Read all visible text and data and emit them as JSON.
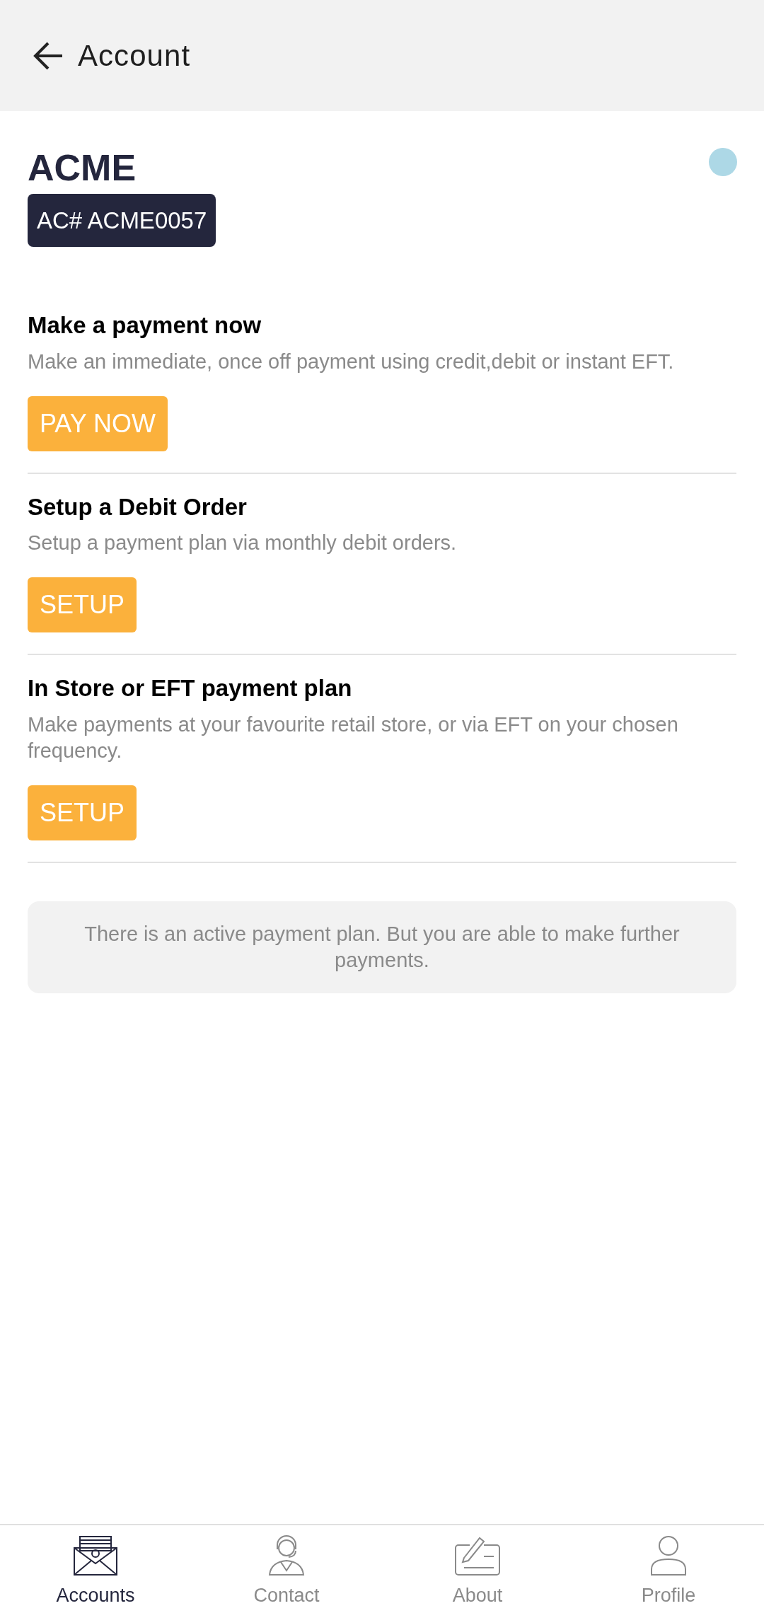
{
  "header": {
    "title": "Account"
  },
  "account": {
    "name": "ACME",
    "number": "AC# ACME0057",
    "color": "#add8e6"
  },
  "options": [
    {
      "title": "Make a payment now",
      "description": "Make an immediate, once off payment using credit,debit or instant EFT.",
      "button": "PAY NOW"
    },
    {
      "title": "Setup a Debit Order",
      "description": "Setup a payment plan via monthly debit orders.",
      "button": "SETUP"
    },
    {
      "title": "In Store or EFT payment plan",
      "description": "Make payments at your favourite retail store, or  via EFT on your chosen frequency.",
      "button": "SETUP"
    }
  ],
  "notice": "There is an active payment plan. But you are able to make further payments.",
  "nav": [
    {
      "label": "Accounts",
      "kind": "accounts",
      "selected": true
    },
    {
      "label": "Contact",
      "kind": "contact",
      "selected": false
    },
    {
      "label": "About",
      "kind": "about",
      "selected": false
    },
    {
      "label": "Profile",
      "kind": "profile",
      "selected": false
    }
  ]
}
